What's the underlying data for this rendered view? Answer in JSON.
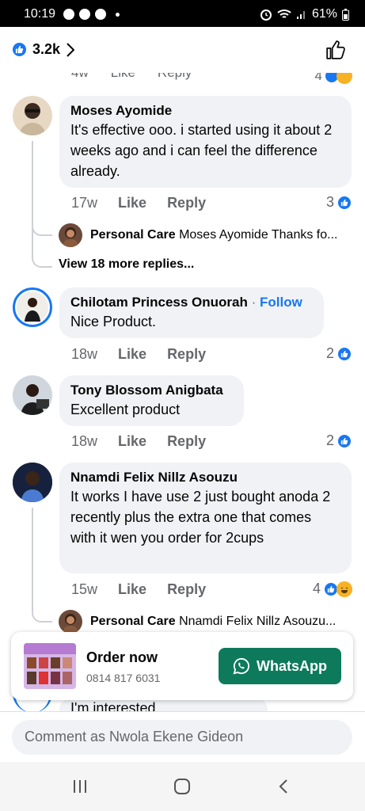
{
  "status_bar": {
    "time": "10:19",
    "battery": "61%"
  },
  "header": {
    "reaction_count": "3.2k"
  },
  "partial_top": {
    "age": "4w",
    "like": "Like",
    "reply": "Reply",
    "count": "4"
  },
  "comments": [
    {
      "name": "Moses Ayomide",
      "text": "It's effective ooo. i started using it about 2 weeks ago and i can feel the difference already.",
      "age": "17w",
      "like": "Like",
      "reply": "Reply",
      "reactions": "3",
      "reply_preview": {
        "name": "Personal Care",
        "text": "Moses Ayomide Thanks fo..."
      },
      "view_more": "View 18 more replies..."
    },
    {
      "name": "Chilotam Princess Onuorah",
      "follow": "Follow",
      "text": "Nice Product.",
      "age": "18w",
      "like": "Like",
      "reply": "Reply",
      "reactions": "2"
    },
    {
      "name": "Tony Blossom Anigbata",
      "text": "Excellent product",
      "age": "18w",
      "like": "Like",
      "reply": "Reply",
      "reactions": "2"
    },
    {
      "name": "Nnamdi Felix Nillz Asouzu",
      "text": "It works I have use 2 just bought anoda 2 recently plus the extra one that comes with it wen you order for 2cups",
      "age": "15w",
      "like": "Like",
      "reply": "Reply",
      "reactions": "4",
      "reply_preview": {
        "name": "Personal Care",
        "text": "Nnamdi Felix Nillz Asouzu..."
      }
    }
  ],
  "ad": {
    "title": "Order now",
    "phone": "0814 817 6031",
    "button": "WhatsApp"
  },
  "partial_bottom_text": "I'm interested",
  "composer": {
    "placeholder": "Comment as Nwola Ekene Gideon"
  },
  "colors": {
    "facebook_blue": "#1877f2",
    "whatsapp_green": "#0d7a5c",
    "bubble_gray": "#f0f2f5"
  }
}
